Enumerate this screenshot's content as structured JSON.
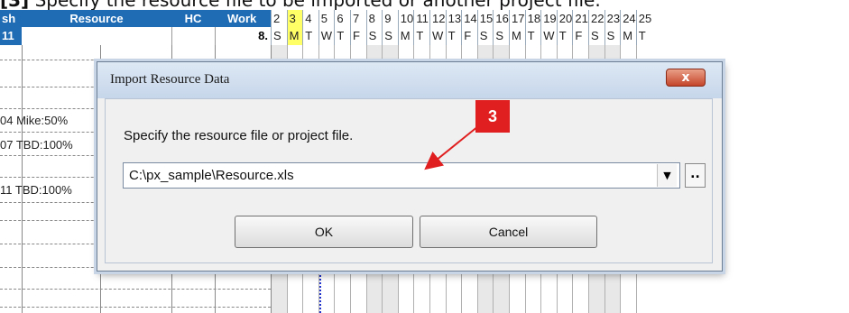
{
  "caption": {
    "step": "[3]",
    "text": "Specify the resource file to be imported or another project file."
  },
  "header": {
    "col_sh": "sh",
    "col_resource": "Resource",
    "col_hc": "HC",
    "col_work": "Work",
    "row_num": "11",
    "work_value": "8.",
    "days": [
      "2",
      "3",
      "4",
      "5",
      "6",
      "7",
      "8",
      "9",
      "10",
      "11",
      "12",
      "13",
      "14",
      "15",
      "16",
      "17",
      "18",
      "19",
      "20",
      "21",
      "22",
      "23",
      "24",
      "25"
    ],
    "weekday_letters": [
      "S",
      "M",
      "T",
      "W",
      "T",
      "F",
      "S",
      "S",
      "M",
      "T",
      "W",
      "T",
      "F",
      "S",
      "S",
      "M",
      "T",
      "W",
      "T",
      "F",
      "S",
      "S",
      "M",
      "T"
    ]
  },
  "rows": [
    {
      "id": "04",
      "resource": "Mike:50%"
    },
    {
      "id": "07",
      "resource": "TBD:100%"
    },
    {
      "id": "11",
      "resource": "TBD:100%"
    }
  ],
  "dialog": {
    "title": "Import Resource Data",
    "close_label": "x",
    "prompt": "Specify the resource file or project file.",
    "file_path": "C:\\px_sample\\Resource.xls",
    "dropdown_glyph": "▼",
    "browse_label": "..",
    "ok_label": "OK",
    "cancel_label": "Cancel"
  },
  "annotation": {
    "badge": "3",
    "color": "#e02020"
  }
}
